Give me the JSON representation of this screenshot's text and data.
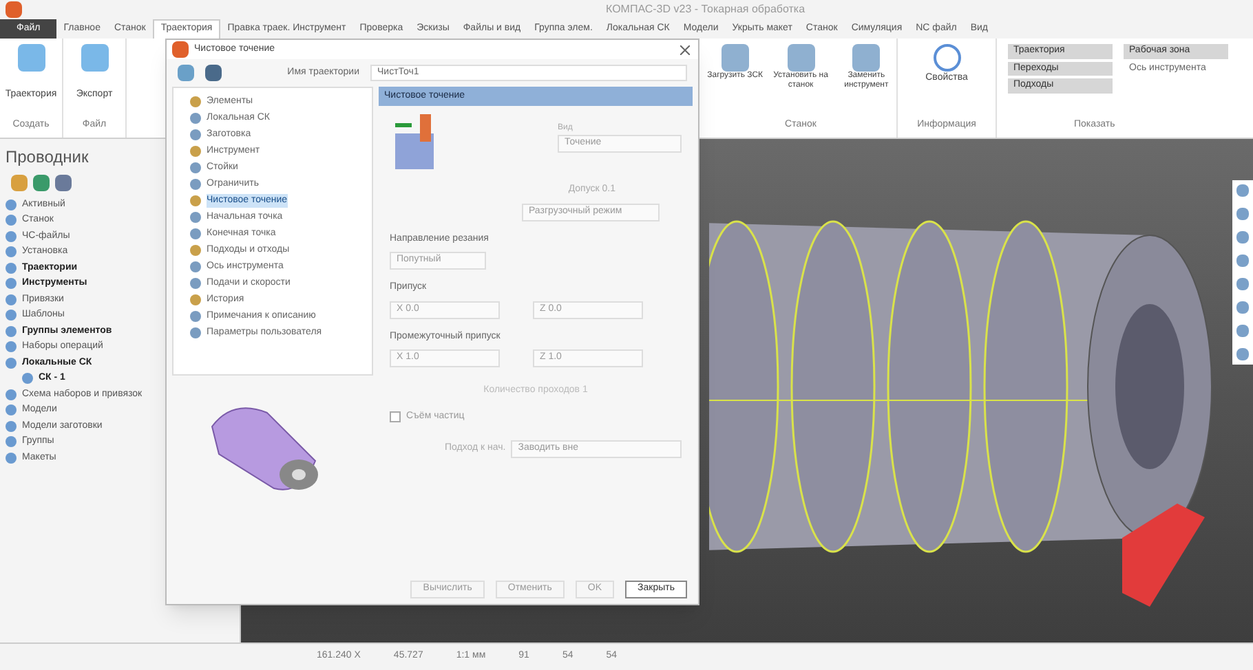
{
  "window": {
    "title": "КОМПАС-3D v23 - Токарная обработка"
  },
  "ribbon_tabs": [
    {
      "label": "Файл",
      "selected": false,
      "kind": "file"
    },
    {
      "label": "Главное",
      "selected": false,
      "kind": "tab"
    },
    {
      "label": "Станок",
      "selected": false,
      "kind": "tab"
    },
    {
      "label": "Траектория",
      "selected": true,
      "kind": "tab"
    },
    {
      "label": "Правка траек. Инструмент",
      "selected": false,
      "kind": "tab"
    },
    {
      "label": "Проверка",
      "selected": false,
      "kind": "tab"
    },
    {
      "label": "Эскизы",
      "selected": false,
      "kind": "tab"
    },
    {
      "label": "Файлы и вид",
      "selected": false,
      "kind": "tab"
    },
    {
      "label": "Группа элем.",
      "selected": false,
      "kind": "tab"
    },
    {
      "label": "Локальная СК",
      "selected": false,
      "kind": "tab"
    },
    {
      "label": "Модели",
      "selected": false,
      "kind": "tab"
    },
    {
      "label": "Укрыть макет",
      "selected": false,
      "kind": "tab"
    },
    {
      "label": "Станок",
      "selected": false,
      "kind": "tab"
    },
    {
      "label": "Симуляция",
      "selected": false,
      "kind": "tab"
    },
    {
      "label": "NC файл",
      "selected": false,
      "kind": "tab"
    },
    {
      "label": "Вид",
      "selected": false,
      "kind": "tab"
    }
  ],
  "ribbon_left": [
    {
      "label": "Траектория",
      "group": "Создать"
    },
    {
      "label": "Экспорт",
      "group": "Файл"
    }
  ],
  "ribbon_right": [
    {
      "label": "Загрузить ЗСК"
    },
    {
      "label": "Установить на станок"
    },
    {
      "label": "Заменить инструмент"
    },
    {
      "label": "Свойства"
    }
  ],
  "ribbon_groups": [
    "Станок",
    "Информация",
    "Показать"
  ],
  "show_toggles": [
    {
      "label": "Траектория",
      "on": true
    },
    {
      "label": "Рабочая зона",
      "on": true
    },
    {
      "label": "Переходы",
      "on": true
    },
    {
      "label": "Ось инструмента",
      "on": false
    },
    {
      "label": "Подходы",
      "on": true
    }
  ],
  "explorer": {
    "title": "Проводник",
    "items": [
      {
        "label": "Активный",
        "bold": false
      },
      {
        "label": "Станок",
        "bold": false
      },
      {
        "label": "ЧС-файлы",
        "bold": false
      },
      {
        "label": "Установка",
        "bold": false
      },
      {
        "label": "Траектории",
        "bold": true
      },
      {
        "label": "Инструменты",
        "bold": true
      },
      {
        "label": "Привязки",
        "bold": false
      },
      {
        "label": "Шаблоны",
        "bold": false
      },
      {
        "label": "Группы элементов",
        "bold": true
      },
      {
        "label": "Наборы операций",
        "bold": false
      },
      {
        "label": "Локальные СК",
        "bold": true,
        "children": [
          {
            "label": "СК - 1",
            "bold": true
          }
        ]
      },
      {
        "label": "Схема наборов и привязок",
        "bold": false
      },
      {
        "label": "Модели",
        "bold": false
      },
      {
        "label": "Модели заготовки",
        "bold": false
      },
      {
        "label": "Группы",
        "bold": false
      },
      {
        "label": "Макеты",
        "bold": false
      }
    ]
  },
  "dialog": {
    "title": "Чистовое точение",
    "name_label": "Имя траектории",
    "name_value": "ЧистТоч1",
    "tree": [
      {
        "label": "Элементы",
        "selected": false
      },
      {
        "label": "Локальная СК",
        "selected": false
      },
      {
        "label": "Заготовка",
        "selected": false
      },
      {
        "label": "Инструмент",
        "selected": false
      },
      {
        "label": "Стойки",
        "selected": false
      },
      {
        "label": "Ограничить",
        "selected": false
      },
      {
        "label": "Чистовое точение",
        "selected": true
      },
      {
        "label": "Начальная точка",
        "selected": false
      },
      {
        "label": "Конечная точка",
        "selected": false
      },
      {
        "label": "Подходы и отходы",
        "selected": false
      },
      {
        "label": "Ось инструмента",
        "selected": false
      },
      {
        "label": "Подачи и скорости",
        "selected": false
      },
      {
        "label": "История",
        "selected": false
      },
      {
        "label": "Примечания к описанию",
        "selected": false
      },
      {
        "label": "Параметры пользователя",
        "selected": false
      }
    ],
    "panel_title": "Чистовое точение",
    "type_label": "Вид",
    "type_value": "Точение",
    "tolerance": "Допуск 0.1",
    "mode_value": "Разгрузочный режим",
    "direction_label": "Направление резания",
    "direction_value": "Попутный",
    "allowance_label": "Припуск",
    "allowance": [
      {
        "axis": "X",
        "value": "0.0"
      },
      {
        "axis": "Z",
        "value": "0.0"
      }
    ],
    "inter_label": "Промежуточный припуск",
    "inter": [
      {
        "axis": "X",
        "value": "1.0"
      },
      {
        "axis": "Z",
        "value": "1.0"
      }
    ],
    "passes": "Количество проходов 1",
    "chip": {
      "label": "Съём частиц",
      "checked": false
    },
    "approach_label": "Подход к нач.",
    "approach_value": "Заводить вне",
    "buttons": [
      "Вычислить",
      "Отменить",
      "OK",
      "Закрыть"
    ]
  },
  "status_bar": [
    "161.240 X",
    "45.727",
    "1:1 мм",
    "91",
    "54",
    "54"
  ]
}
